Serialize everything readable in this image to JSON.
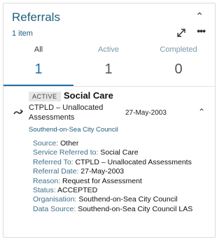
{
  "header": {
    "title": "Referrals",
    "count": "1 item"
  },
  "tabs": [
    {
      "label": "All",
      "count": "1"
    },
    {
      "label": "Active",
      "count": "1"
    },
    {
      "label": "Completed",
      "count": "0"
    }
  ],
  "referral": {
    "status": "ACTIVE",
    "title": "Social Care",
    "subtitle": "CTPLD – Unallocated Assessments",
    "date": "27-May-2003",
    "org": "Southend-on-Sea City Council",
    "details": [
      {
        "key": "Source:",
        "value": "Other"
      },
      {
        "key": "Service Referred to:",
        "value": "Social Care"
      },
      {
        "key": "Referred To:",
        "value": "CTPLD – Unallocated Assessments"
      },
      {
        "key": "Referral Date:",
        "value": "27-May-2003"
      },
      {
        "key": "Reason:",
        "value": "Request for Assessment"
      },
      {
        "key": "Status:",
        "value": "ACCEPTED"
      },
      {
        "key": "Organisation:",
        "value": "Southend-on-Sea City Council"
      },
      {
        "key": "Data Source:",
        "value": "Southend-on-Sea City Council LAS"
      }
    ]
  },
  "icons": {
    "collapse": "chevron-up-icon",
    "expand": "expand-arrows-icon",
    "more": "more-horizontal-icon",
    "referral": "referral-arrow-icon"
  },
  "colors": {
    "accent": "#1f6fa8",
    "title": "#1f5e7e",
    "label": "#3e6f8c"
  }
}
